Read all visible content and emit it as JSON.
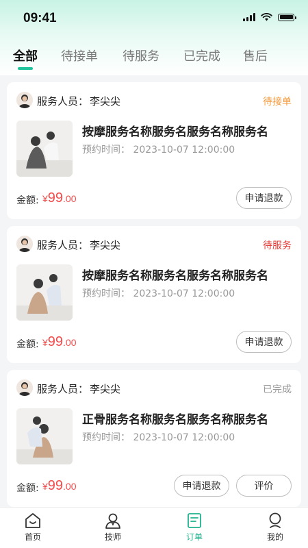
{
  "status_bar": {
    "time": "09:41"
  },
  "tabs": [
    {
      "label": "全部",
      "active": true
    },
    {
      "label": "待接单",
      "active": false
    },
    {
      "label": "待服务",
      "active": false
    },
    {
      "label": "已完成",
      "active": false
    },
    {
      "label": "售后",
      "active": false
    }
  ],
  "orders": [
    {
      "staff_label": "服务人员：",
      "staff_name": "李尖尖",
      "status": "待接单",
      "status_color": "#f39a3b",
      "service_name": "按摩服务名称服务名服务名称服务名",
      "appointment": "预约时间：  2023-10-07 12:00:00",
      "amount_label": "金额:",
      "price_symbol": "¥",
      "price_int": "99",
      "price_dec": ".00",
      "refund_label": "申请退款"
    },
    {
      "staff_label": "服务人员：",
      "staff_name": "李尖尖",
      "status": "待服务",
      "status_color": "#e53935",
      "service_name": "按摩服务名称服务名服务名称服务名",
      "appointment": "预约时间：  2023-10-07 12:00:00",
      "amount_label": "金额:",
      "price_symbol": "¥",
      "price_int": "99",
      "price_dec": ".00",
      "refund_label": "申请退款"
    },
    {
      "staff_label": "服务人员：",
      "staff_name": "李尖尖",
      "status": "已完成",
      "status_color": "#999999",
      "service_name": "正骨服务名称服务名服务名称服务名",
      "appointment": "预约时间：  2023-10-07 12:00:00",
      "amount_label": "金额:",
      "price_symbol": "¥",
      "price_int": "99",
      "price_dec": ".00",
      "refund_label": "申请退款",
      "review_label": "评价"
    }
  ],
  "bottom_nav": [
    {
      "label": "首页",
      "icon": "home-icon"
    },
    {
      "label": "技师",
      "icon": "technician-icon"
    },
    {
      "label": "订单",
      "icon": "orders-icon",
      "active": true
    },
    {
      "label": "我的",
      "icon": "profile-icon"
    }
  ],
  "colors": {
    "accent": "#1fc49c",
    "price": "#f44b4b"
  }
}
